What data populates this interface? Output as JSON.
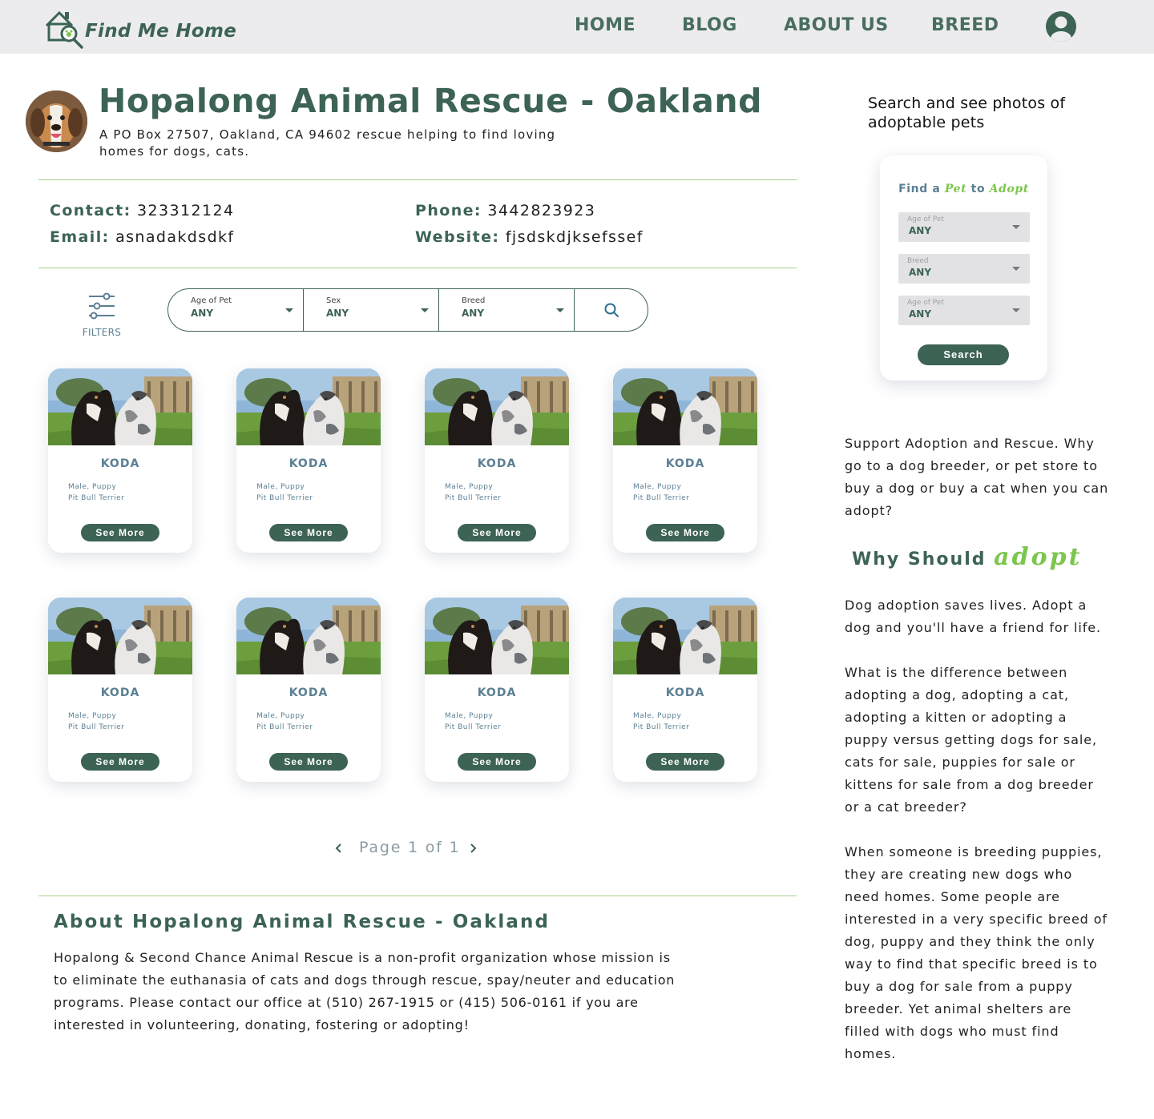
{
  "brand": {
    "name": "Find Me Home"
  },
  "nav": {
    "items": [
      {
        "label": "HOME"
      },
      {
        "label": "BLOG"
      },
      {
        "label": "ABOUT US"
      },
      {
        "label": "BREED"
      }
    ]
  },
  "rescue": {
    "name": "Hopalong Animal Rescue - Oakland",
    "description": "A PO Box 27507, Oakland, CA 94602 rescue helping to find loving homes for dogs, cats."
  },
  "contact": {
    "contact_label": "Contact:",
    "contact_value": "323312124",
    "phone_label": "Phone:",
    "phone_value": "3442823923",
    "email_label": "Email:",
    "email_value": "asnadakdsdkf",
    "website_label": "Website:",
    "website_value": "fjsdskdjksefssef"
  },
  "filters": {
    "label": "FILTERS",
    "fields": [
      {
        "label": "Age of Pet",
        "value": "ANY"
      },
      {
        "label": "Sex",
        "value": "ANY"
      },
      {
        "label": "Breed",
        "value": "ANY"
      }
    ]
  },
  "pets": [
    {
      "name": "KODA",
      "line1": "Male, Puppy",
      "line2": "Pit Bull Terrier",
      "button": "See More"
    },
    {
      "name": "KODA",
      "line1": "Male, Puppy",
      "line2": "Pit Bull Terrier",
      "button": "See More"
    },
    {
      "name": "KODA",
      "line1": "Male, Puppy",
      "line2": "Pit Bull Terrier",
      "button": "See More"
    },
    {
      "name": "KODA",
      "line1": "Male, Puppy",
      "line2": "Pit Bull Terrier",
      "button": "See More"
    },
    {
      "name": "KODA",
      "line1": "Male, Puppy",
      "line2": "Pit Bull Terrier",
      "button": "See More"
    },
    {
      "name": "KODA",
      "line1": "Male, Puppy",
      "line2": "Pit Bull Terrier",
      "button": "See More"
    },
    {
      "name": "KODA",
      "line1": "Male, Puppy",
      "line2": "Pit Bull Terrier",
      "button": "See More"
    },
    {
      "name": "KODA",
      "line1": "Male, Puppy",
      "line2": "Pit Bull Terrier",
      "button": "See More"
    }
  ],
  "pagination": {
    "text": "Page 1 of 1",
    "current": 1,
    "total": 1
  },
  "about": {
    "title": "About Hopalong Animal Rescue - Oakland",
    "text": "Hopalong & Second Chance Animal Rescue is a non-profit organization whose mission is to eliminate the euthanasia of cats and dogs through rescue, spay/neuter and education programs. Please contact our office at (510) 267-1915 or (415) 506-0161 if you are interested in volunteering, donating, fostering or adopting!"
  },
  "sidebar": {
    "heading": "Search and see photos of adoptable pets",
    "find_widget": {
      "title_part1": "Find a ",
      "title_part2": "Pet",
      "title_part3": " to ",
      "title_part4": "Adopt",
      "dropdowns": [
        {
          "label": "Age of Pet",
          "value": "ANY"
        },
        {
          "label": "Breed",
          "value": "ANY"
        },
        {
          "label": "Age of Pet",
          "value": "ANY"
        }
      ],
      "button": "Search"
    },
    "support_text": "Support Adoption and Rescue. Why go to a dog breeder, or pet store to buy a dog or buy a cat when you can adopt?",
    "why_part1": "Why Should ",
    "why_part2": "adopt",
    "para1": "Dog adoption saves lives. Adopt a dog and you'll have a friend for life.",
    "para2": "What is the difference between adopting a dog, adopting a cat, adopting a kitten or adopting a puppy versus getting dogs for sale, cats for sale, puppies for sale or kittens for sale from a dog breeder or a cat breeder?",
    "para3": "When someone is breeding puppies, they are creating new dogs who need homes. Some people are interested in a very specific breed of dog, puppy and they think the only way to find that specific breed is to buy a dog for sale from a puppy breeder. Yet animal shelters are filled with dogs who must find homes."
  },
  "colors": {
    "primary": "#3c6354",
    "accent": "#7cc64d",
    "muted": "#5b7f93",
    "divider": "#a8d08d"
  }
}
